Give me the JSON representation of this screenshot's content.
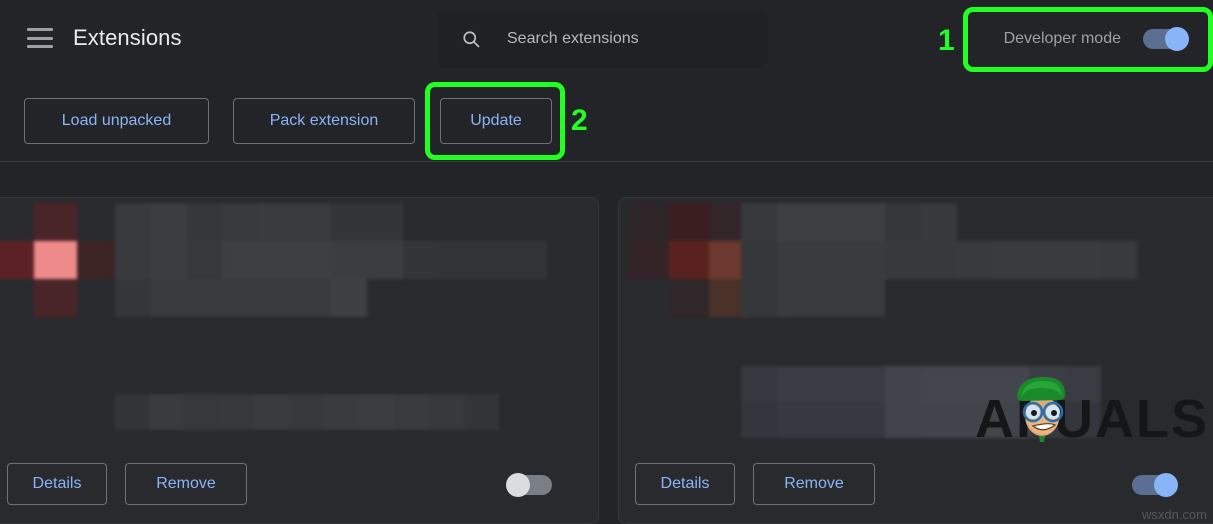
{
  "window": {
    "background_color": "#232427",
    "card_color": "#292A2D",
    "accent_link_color": "#8ab4f8",
    "annotation_color": "#22ff22"
  },
  "header": {
    "menu_icon": "hamburger-menu-icon",
    "title": "Extensions",
    "search": {
      "icon": "search-icon",
      "placeholder": "Search extensions",
      "value": ""
    },
    "developer_mode": {
      "label": "Developer mode",
      "toggle_state": "on"
    }
  },
  "toolbar": {
    "load_unpacked_label": "Load unpacked",
    "pack_extension_label": "Pack extension",
    "update_label": "Update"
  },
  "annotations": [
    {
      "number": "1",
      "target": "developer-mode-toggle"
    },
    {
      "number": "2",
      "target": "update-button"
    }
  ],
  "extension_cards": [
    {
      "id": "extension-card-left",
      "name_redacted": true,
      "description_redacted": true,
      "details_label": "Details",
      "remove_label": "Remove",
      "enabled_toggle_state": "off"
    },
    {
      "id": "extension-card-right",
      "name_redacted": true,
      "description_redacted": true,
      "details_label": "Details",
      "remove_label": "Remove",
      "enabled_toggle_state": "on"
    }
  ],
  "watermarks": {
    "brand_text": "PUALS",
    "brand_initial": "A",
    "footer_text": "wsxdn.com"
  }
}
